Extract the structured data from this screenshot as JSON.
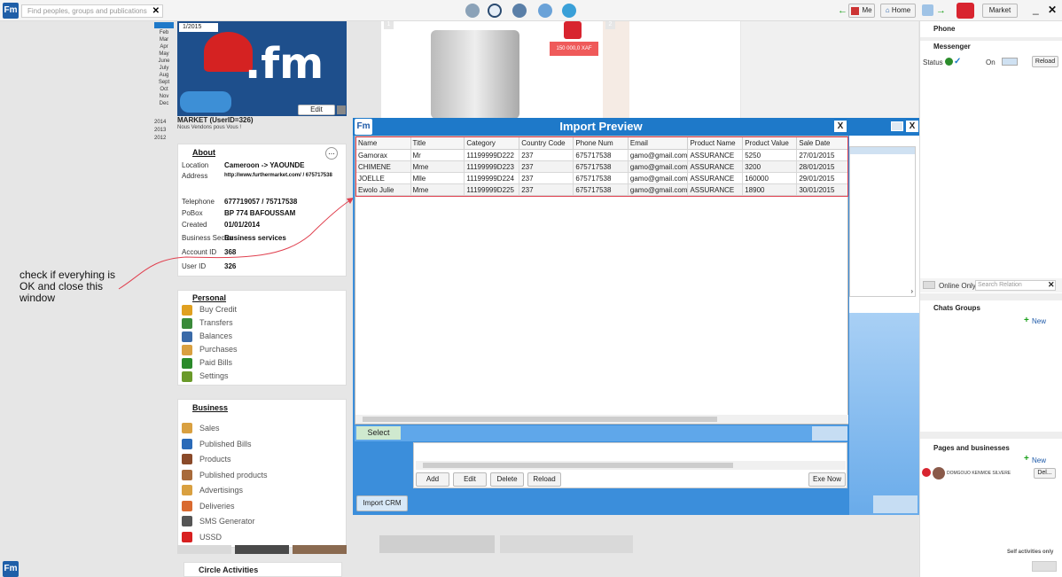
{
  "topbar": {
    "search_placeholder": "Find peoples, groups and publications",
    "me_label": "Me",
    "home_label": "Home",
    "market_label": "Market"
  },
  "calendar": {
    "months": [
      "Feb",
      "Mar",
      "Apr",
      "May",
      "June",
      "July",
      "Aug",
      "Sept",
      "Oct",
      "Nov",
      "Dec"
    ],
    "years": [
      "2014",
      "2013",
      "2012"
    ]
  },
  "profile": {
    "date_badge": "1/2015",
    "logo_text": ".fm",
    "edit_label": "Edit",
    "name": "MARKET (UserID=326)",
    "tagline": "Nous Vendons pous Vous !"
  },
  "about": {
    "title": "About",
    "more": "...",
    "rows": [
      {
        "label": "Location",
        "value": "Cameroon -> YAOUNDE"
      },
      {
        "label": "Address",
        "value": "http://www.furthermarket.com/ / 675717538"
      },
      {
        "label": "Telephone",
        "value": "677719057 / 75717538"
      },
      {
        "label": "PoBox",
        "value": "BP 774 BAFOUSSAM"
      },
      {
        "label": "Created",
        "value": "01/01/2014"
      },
      {
        "label": "Business Sector",
        "value": "Business services"
      },
      {
        "label": "Account ID",
        "value": "368"
      },
      {
        "label": "User ID",
        "value": "326"
      }
    ]
  },
  "personal": {
    "title": "Personal",
    "items": [
      "Buy Credit",
      "Transfers",
      "Balances",
      "Purchases",
      "Paid Bills",
      "Settings"
    ]
  },
  "business": {
    "title": "Business",
    "items": [
      "Sales",
      "Published Bills",
      "Products",
      "Published products",
      "Advertisings",
      "Deliveries",
      "SMS Generator",
      "USSD"
    ]
  },
  "circle": {
    "title": "Circle Activities"
  },
  "annotation": {
    "text": "check if everyhing is OK and close this window"
  },
  "product": {
    "price": "150 000,0 XAF",
    "slot1": "1",
    "slot2": "2"
  },
  "modal": {
    "title": "Import Preview",
    "close": "X",
    "columns": [
      "Name",
      "Title",
      "Category",
      "Country Code",
      "Phone Num",
      "Email",
      "Product Name",
      "Product Value",
      "Sale Date"
    ],
    "rows": [
      [
        "Gamorax",
        "Mr",
        "11199999D222",
        "237",
        "675717538",
        "gamo@gmail.com",
        "ASSURANCE",
        "5250",
        "27/01/2015"
      ],
      [
        "CHIMENE",
        "Mme",
        "11199999D223",
        "237",
        "675717538",
        "gamo@gmail.com",
        "ASSURANCE",
        "3200",
        "28/01/2015"
      ],
      [
        "JOELLE",
        "Mlle",
        "11199999D224",
        "237",
        "675717538",
        "gamo@gmail.com",
        "ASSURANCE",
        "160000",
        "29/01/2015"
      ],
      [
        "Ewolo Julie",
        "Mme",
        "11199999D225",
        "237",
        "675717538",
        "gamo@gmail.com",
        "ASSURANCE",
        "18900",
        "30/01/2015"
      ]
    ],
    "select_label": "Select",
    "buttons": [
      "Add",
      "Edit",
      "Delete",
      "Reload"
    ],
    "exe_label": "Exe Now",
    "import_label": "Import CRM"
  },
  "outer_window": {
    "close": "X"
  },
  "right": {
    "phone": "Phone",
    "messenger": "Messenger",
    "status_label": "Status",
    "on_label": "On",
    "reload_label": "Reload",
    "online_only": "Online Only",
    "search_relation": "Search Relation",
    "chats_groups": "Chats Groups",
    "new_label": "New",
    "pages_businesses": "Pages and businesses",
    "new_label2": "New",
    "contact_name": "DOMGOUO KENMOE SILVERE",
    "del_label": "Del...",
    "self_activities": "Self activities only"
  },
  "colors": {
    "accent": "#1e79c9",
    "highlight": "#e0404f",
    "select_btn": "#cfe9cf"
  }
}
